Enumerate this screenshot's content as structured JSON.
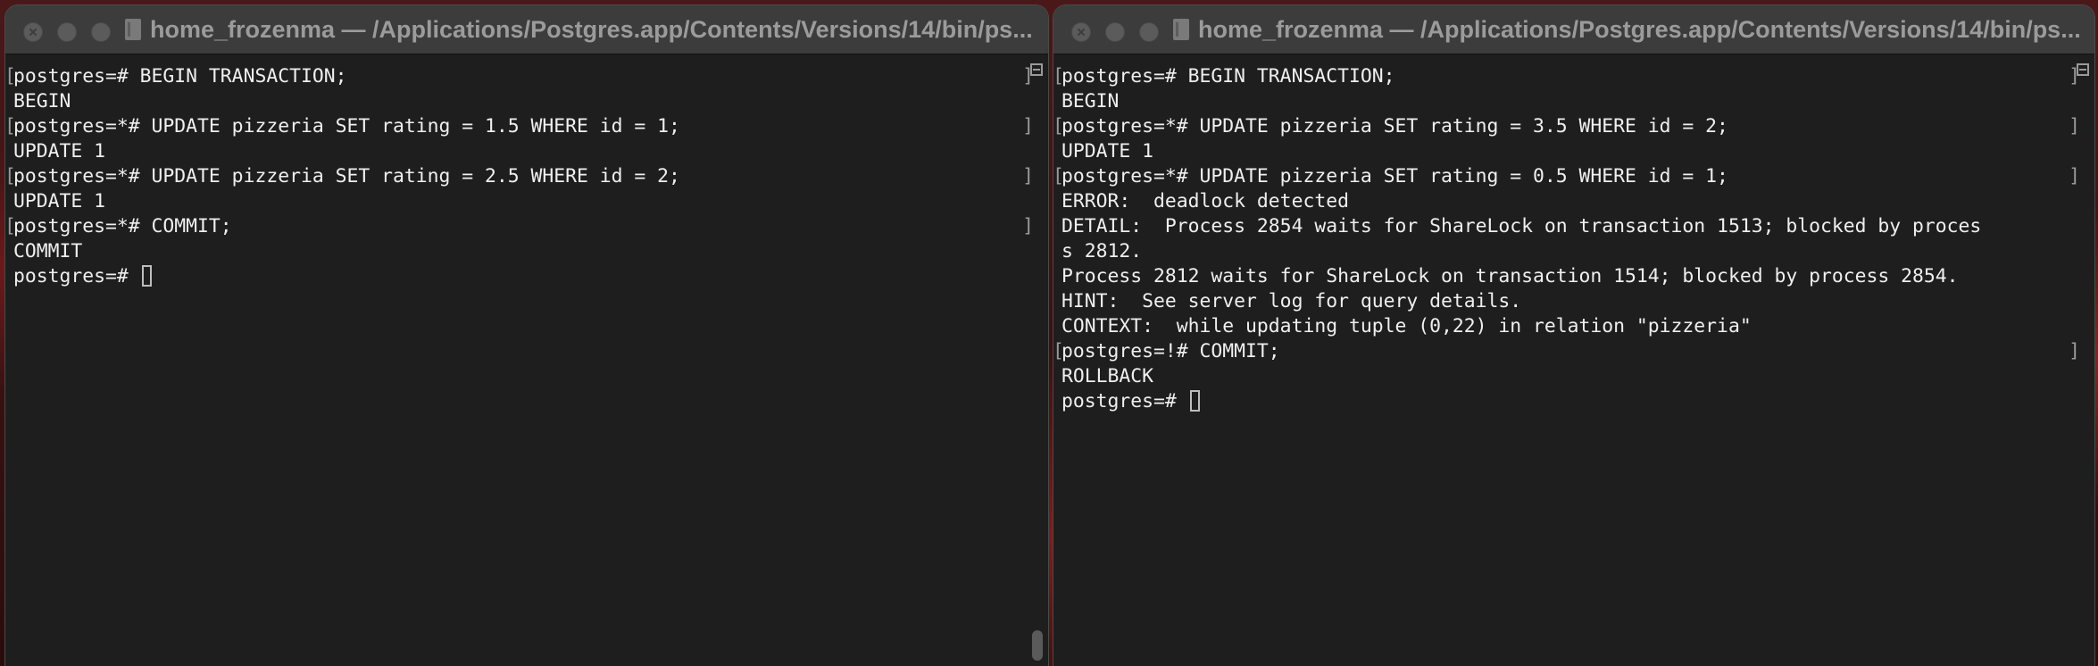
{
  "windows": [
    {
      "title": "home_frozenma — /Applications/Postgres.app/Contents/Versions/14/bin/ps...",
      "lines": [
        {
          "text": "postgres=# BEGIN TRANSACTION;",
          "marked": true
        },
        {
          "text": "BEGIN",
          "marked": false
        },
        {
          "text": "postgres=*# UPDATE pizzeria SET rating = 1.5 WHERE id = 1;",
          "marked": true
        },
        {
          "text": "UPDATE 1",
          "marked": false
        },
        {
          "text": "postgres=*# UPDATE pizzeria SET rating = 2.5 WHERE id = 2;",
          "marked": true
        },
        {
          "text": "UPDATE 1",
          "marked": false
        },
        {
          "text": "postgres=*# COMMIT;",
          "marked": true
        },
        {
          "text": "COMMIT",
          "marked": false
        },
        {
          "text": "postgres=# ",
          "marked": false,
          "cursor": true
        }
      ]
    },
    {
      "title": "home_frozenma — /Applications/Postgres.app/Contents/Versions/14/bin/ps...",
      "lines": [
        {
          "text": "postgres=# BEGIN TRANSACTION;",
          "marked": true
        },
        {
          "text": "BEGIN",
          "marked": false
        },
        {
          "text": "postgres=*# UPDATE pizzeria SET rating = 3.5 WHERE id = 2;",
          "marked": true
        },
        {
          "text": "UPDATE 1",
          "marked": false
        },
        {
          "text": "postgres=*# UPDATE pizzeria SET rating = 0.5 WHERE id = 1;",
          "marked": true
        },
        {
          "text": "ERROR:  deadlock detected",
          "marked": false
        },
        {
          "text": "DETAIL:  Process 2854 waits for ShareLock on transaction 1513; blocked by proces",
          "marked": false
        },
        {
          "text": "s 2812.",
          "marked": false
        },
        {
          "text": "Process 2812 waits for ShareLock on transaction 1514; blocked by process 2854.",
          "marked": false
        },
        {
          "text": "HINT:  See server log for query details.",
          "marked": false
        },
        {
          "text": "CONTEXT:  while updating tuple (0,22) in relation \"pizzeria\"",
          "marked": false
        },
        {
          "text": "postgres=!# COMMIT;",
          "marked": true
        },
        {
          "text": "ROLLBACK",
          "marked": false
        },
        {
          "text": "postgres=# ",
          "marked": false,
          "cursor": true
        }
      ]
    }
  ]
}
